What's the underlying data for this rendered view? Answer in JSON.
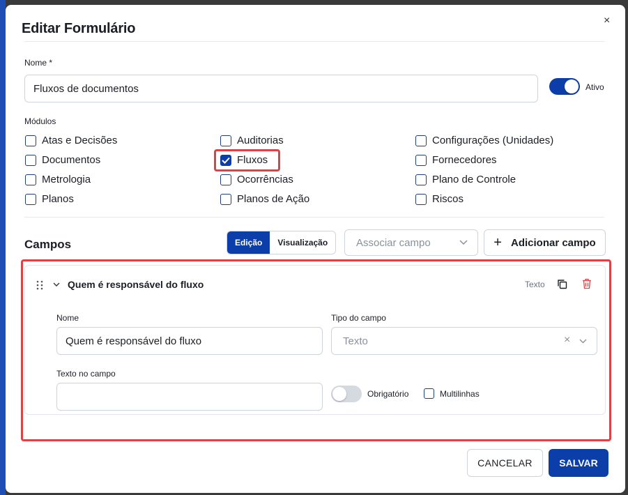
{
  "dialog": {
    "title": "Editar Formulário",
    "close_label": "×"
  },
  "name_field": {
    "label": "Nome *",
    "value": "Fluxos de documentos"
  },
  "active_toggle": {
    "label": "Ativo",
    "on": true
  },
  "modules": {
    "label": "Módulos",
    "items": [
      {
        "label": "Atas e Decisões",
        "checked": false
      },
      {
        "label": "Documentos",
        "checked": false
      },
      {
        "label": "Metrologia",
        "checked": false
      },
      {
        "label": "Planos",
        "checked": false
      },
      {
        "label": "Auditorias",
        "checked": false
      },
      {
        "label": "Fluxos",
        "checked": true
      },
      {
        "label": "Ocorrências",
        "checked": false
      },
      {
        "label": "Planos de Ação",
        "checked": false
      },
      {
        "label": "Configurações (Unidades)",
        "checked": false
      },
      {
        "label": "Fornecedores",
        "checked": false
      },
      {
        "label": "Plano de Controle",
        "checked": false
      },
      {
        "label": "Riscos",
        "checked": false
      }
    ]
  },
  "fields_section": {
    "title": "Campos",
    "mode_edit": "Edição",
    "mode_view": "Visualização",
    "associate_placeholder": "Associar campo",
    "add_field_label": "Adicionar campo",
    "add_icon": "+"
  },
  "field_card": {
    "title": "Quem é responsável do fluxo",
    "type_badge": "Texto",
    "name_label": "Nome",
    "name_value": "Quem é responsável do fluxo",
    "type_label": "Tipo do campo",
    "type_value": "Texto",
    "placeholder_label": "Texto no campo",
    "placeholder_value": "",
    "required_label": "Obrigatório",
    "required_on": false,
    "multiline_label": "Multilinhas",
    "multiline_checked": false
  },
  "footer": {
    "cancel_label": "CANCELAR",
    "save_label": "SALVAR"
  },
  "colors": {
    "primary": "#0b3ea8",
    "highlight": "#d9434a",
    "delete": "#d9434a"
  }
}
